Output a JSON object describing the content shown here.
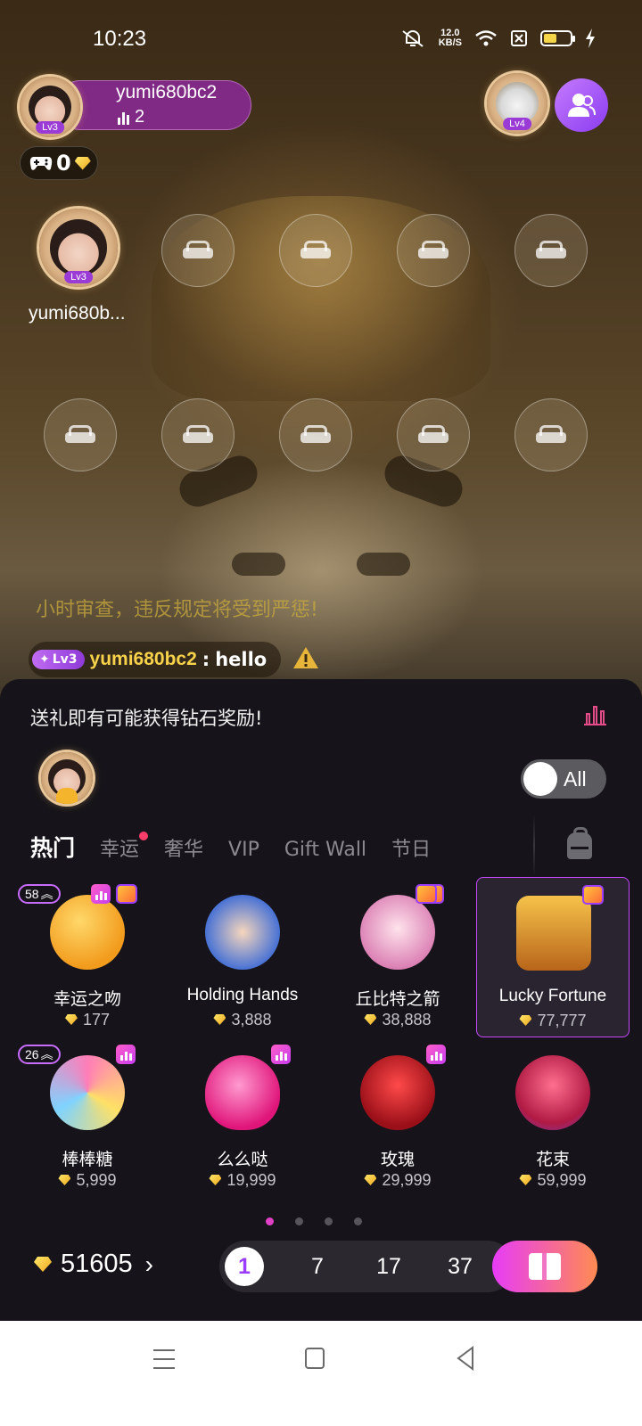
{
  "status_bar": {
    "time": "10:23",
    "net_speed_value": "12.0",
    "net_speed_unit": "KB/S",
    "battery_level": 0.5,
    "icons": [
      "mute-icon",
      "wifi-icon",
      "sim-off-icon",
      "battery-icon",
      "charging-icon"
    ]
  },
  "host": {
    "name": "yumi680bc2",
    "online_count": "2",
    "level": "Lv3"
  },
  "owner": {
    "level": "Lv4"
  },
  "game_chip": {
    "value": "0"
  },
  "seats": {
    "occupied_user_name": "yumi680b...",
    "occupied_level": "Lv3",
    "empty_seat_count": 9
  },
  "chat": {
    "notice": "小时审查，违反规定将受到严惩!",
    "message": {
      "level": "Lv3",
      "user": "yumi680bc2",
      "separator": " : ",
      "text": "hello"
    }
  },
  "gift_panel": {
    "promo_text": "送礼即有可能获得钻石奖励!",
    "toggle_label": "All",
    "tabs": [
      {
        "label": "热门",
        "active": true
      },
      {
        "label": "幸运",
        "active": false,
        "dot": true
      },
      {
        "label": "奢华",
        "active": false
      },
      {
        "label": "VIP",
        "active": false
      },
      {
        "label": "Gift Wall",
        "active": false
      },
      {
        "label": "节日",
        "active": false
      }
    ],
    "gifts": [
      {
        "name": "幸运之吻",
        "price": "177",
        "level": "58",
        "icon": "kiss-face-icon",
        "color": "#f7b52a"
      },
      {
        "name": "Holding Hands",
        "price": "3,888",
        "icon": "holding-hands-icon",
        "color": "#f4c6a2"
      },
      {
        "name": "丘比特之箭",
        "price": "38,888",
        "icon": "cupid-icon",
        "color": "#f2c9d8"
      },
      {
        "name": "Lucky Fortune",
        "price": "77,777",
        "icon": "treasure-chest-icon",
        "color": "#e8a21e",
        "selected": true
      },
      {
        "name": "棒棒糖",
        "price": "5,999",
        "level": "26",
        "icon": "lollipop-icon",
        "color": "#f58fb8"
      },
      {
        "name": "么么哒",
        "price": "19,999",
        "icon": "lips-icon",
        "color": "#ff3f9a"
      },
      {
        "name": "玫瑰",
        "price": "29,999",
        "icon": "rose-icon",
        "color": "#e0242f"
      },
      {
        "name": "花束",
        "price": "59,999",
        "icon": "bouquet-icon",
        "color": "#ff3d6c"
      }
    ],
    "page_count": 4,
    "active_page": 1,
    "balance": "51605",
    "quantities": [
      "1",
      "7",
      "17",
      "37"
    ],
    "selected_quantity": "1"
  },
  "colors": {
    "accent": "#c648ff",
    "gem": "#f5c33a",
    "panel_bg": "#16141a",
    "send_gradient_start": "#e73cf7",
    "send_gradient_end": "#ff8b52"
  }
}
